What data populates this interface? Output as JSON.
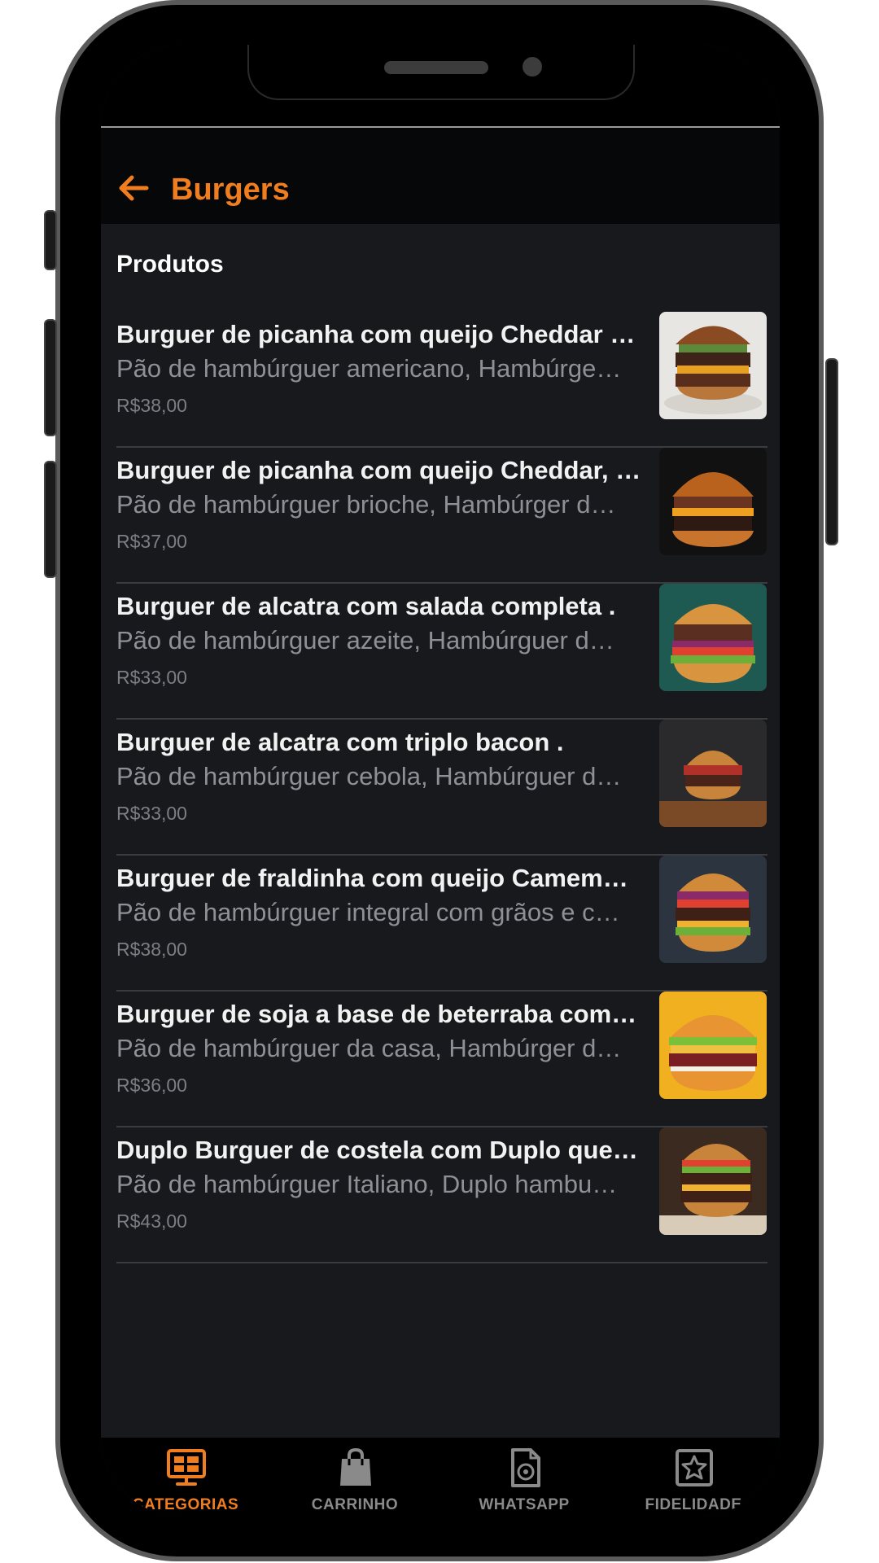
{
  "colors": {
    "accent": "#f07d1e",
    "background": "#17191d",
    "appbar": "#060709",
    "text_primary": "#f2f2f2",
    "text_secondary": "#8e9096"
  },
  "appbar": {
    "title": "Burgers",
    "back_icon": "arrow-left-icon"
  },
  "section": {
    "title": "Produtos"
  },
  "products": [
    {
      "name": "Burguer de picanha com queijo Cheddar …",
      "description": "Pão de hambúrguer americano, Hambúrge…",
      "price": "R$38,00",
      "image": "burger-photo-1"
    },
    {
      "name": "Burguer de picanha com queijo Cheddar, …",
      "description": "Pão de hambúrguer brioche, Hambúrger d…",
      "price": "R$37,00",
      "image": "burger-photo-2"
    },
    {
      "name": "Burguer de alcatra com salada completa .",
      "description": "Pão de hambúrguer azeite, Hambúrguer d…",
      "price": "R$33,00",
      "image": "burger-photo-3"
    },
    {
      "name": "Burguer de alcatra com triplo bacon .",
      "description": "Pão de hambúrguer cebola, Hambúrguer d…",
      "price": "R$33,00",
      "image": "burger-photo-4"
    },
    {
      "name": "Burguer de fraldinha com queijo Camem…",
      "description": "Pão de hambúrguer integral com grãos e c…",
      "price": "R$38,00",
      "image": "burger-photo-5"
    },
    {
      "name": "Burguer de soja a base de beterraba com…",
      "description": "Pão de hambúrguer da casa, Hambúrger d…",
      "price": "R$36,00",
      "image": "burger-photo-6"
    },
    {
      "name": "Duplo Burguer de costela com Duplo que…",
      "description": "Pão de hambúrguer Italiano, Duplo hambu…",
      "price": "R$43,00",
      "image": "burger-photo-7"
    }
  ],
  "bottom_nav": [
    {
      "label": "CATEGORIAS",
      "icon": "menu-board-icon",
      "active": true
    },
    {
      "label": "CARRINHO",
      "icon": "shopping-bag-icon",
      "active": false
    },
    {
      "label": "WHATSAPP",
      "icon": "document-icon",
      "active": false
    },
    {
      "label": "FIDELIDADE",
      "icon": "star-badge-icon",
      "active": false
    }
  ]
}
